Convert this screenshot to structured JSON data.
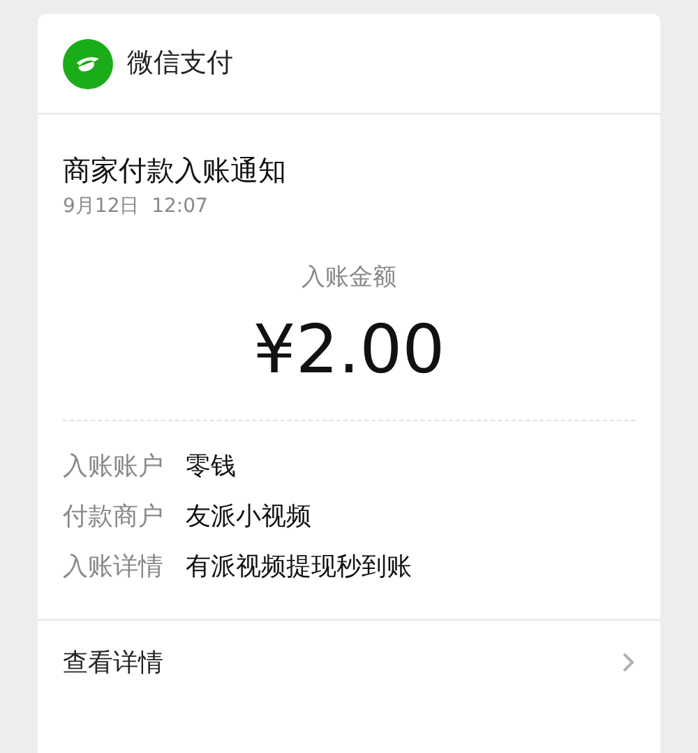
{
  "header": {
    "title": "微信支付"
  },
  "notice": {
    "title": "商家付款入账通知",
    "time": "9月12日  12:07"
  },
  "amount": {
    "label": "入账金额",
    "value": "¥2.00"
  },
  "details": [
    {
      "label": "入账账户",
      "value": "零钱"
    },
    {
      "label": "付款商户",
      "value": "友派小视频"
    },
    {
      "label": "入账详情",
      "value": "有派视频提现秒到账"
    }
  ],
  "footer": {
    "link": "查看详情"
  }
}
